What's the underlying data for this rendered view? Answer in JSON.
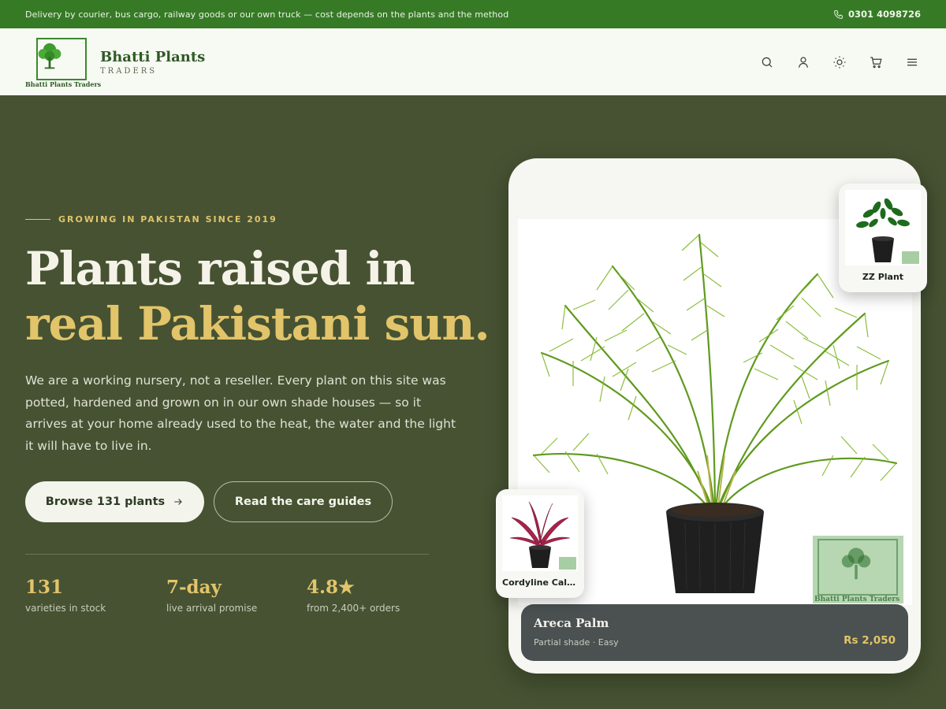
{
  "topbar": {
    "message": "Delivery by courier, bus cargo, railway goods or our own truck — cost depends on the plants and the method",
    "phone": "0301 4098726",
    "phone_icon": "phone-icon"
  },
  "header": {
    "brand_name": "Bhatti Plants",
    "brand_sub": "TRADERS",
    "logo_caption": "Bhatti Plants Traders",
    "icons": [
      "search-icon",
      "user-icon",
      "sun-icon",
      "cart-icon",
      "menu-icon"
    ]
  },
  "hero": {
    "eyebrow": "GROWING IN PAKISTAN SINCE 2019",
    "title_line1": "Plants raised in",
    "title_line2": "real Pakistani sun.",
    "lead": "We are a working nursery, not a reseller. Every plant on this site was potted, hardened and grown on in our own shade houses — so it arrives at your home already used to the heat, the water and the light it will have to live in.",
    "primary_button": "Browse 131 plants",
    "secondary_button": "Read the care guides",
    "stats": [
      {
        "value": "131",
        "label": "varieties in stock"
      },
      {
        "value": "7-day",
        "label": "live arrival promise"
      },
      {
        "value": "4.8★",
        "label": "from 2,400+ orders"
      }
    ]
  },
  "featured": {
    "name": "Areca Palm",
    "meta": "Partial shade · Easy",
    "price": "Rs 2,050",
    "watermark": "Bhatti Plants Traders"
  },
  "mini_cards": [
    {
      "label": "ZZ Plant"
    },
    {
      "label": "Cordyline Calypso"
    }
  ],
  "colors": {
    "topbar": "#367a26",
    "hero_bg": "#465232",
    "accent_gold": "#e2c46a",
    "header_bg": "#f7f9f3"
  }
}
